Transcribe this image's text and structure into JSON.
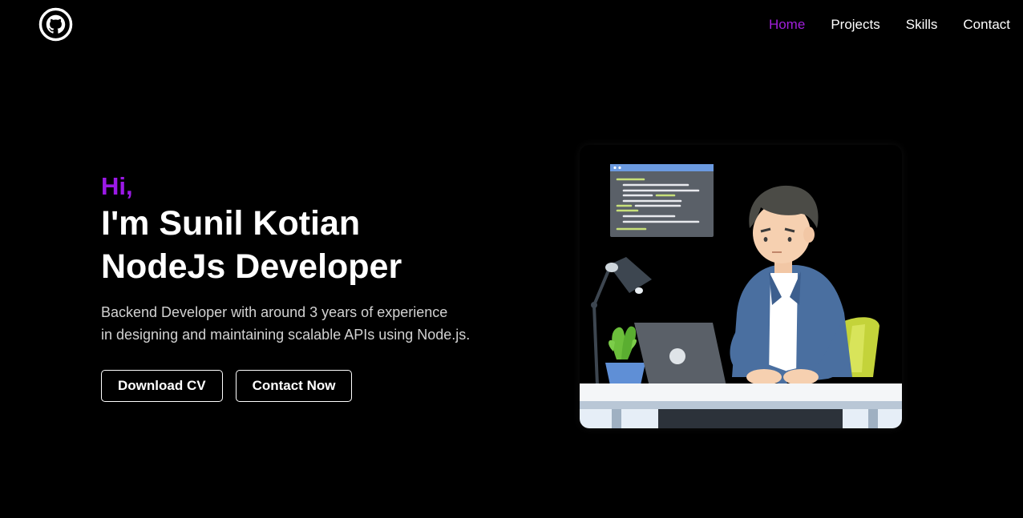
{
  "header": {
    "logo_icon": "github-icon",
    "nav": [
      {
        "label": "Home",
        "active": true
      },
      {
        "label": "Projects",
        "active": false
      },
      {
        "label": "Skills",
        "active": false
      },
      {
        "label": "Contact",
        "active": false
      }
    ]
  },
  "hero": {
    "greeting": "Hi,",
    "name_line": "I'm Sunil Kotian",
    "role_line": "NodeJs Developer",
    "desc_line1": "Backend Developer with around 3 years of experience",
    "desc_line2": "in designing and maintaining scalable APIs using Node.js.",
    "download_label": "Download CV",
    "contact_label": "Contact Now"
  },
  "colors": {
    "accent": "#9b19e6",
    "nav_active": "#a11fdb",
    "background": "#000000",
    "text": "#ffffff"
  }
}
